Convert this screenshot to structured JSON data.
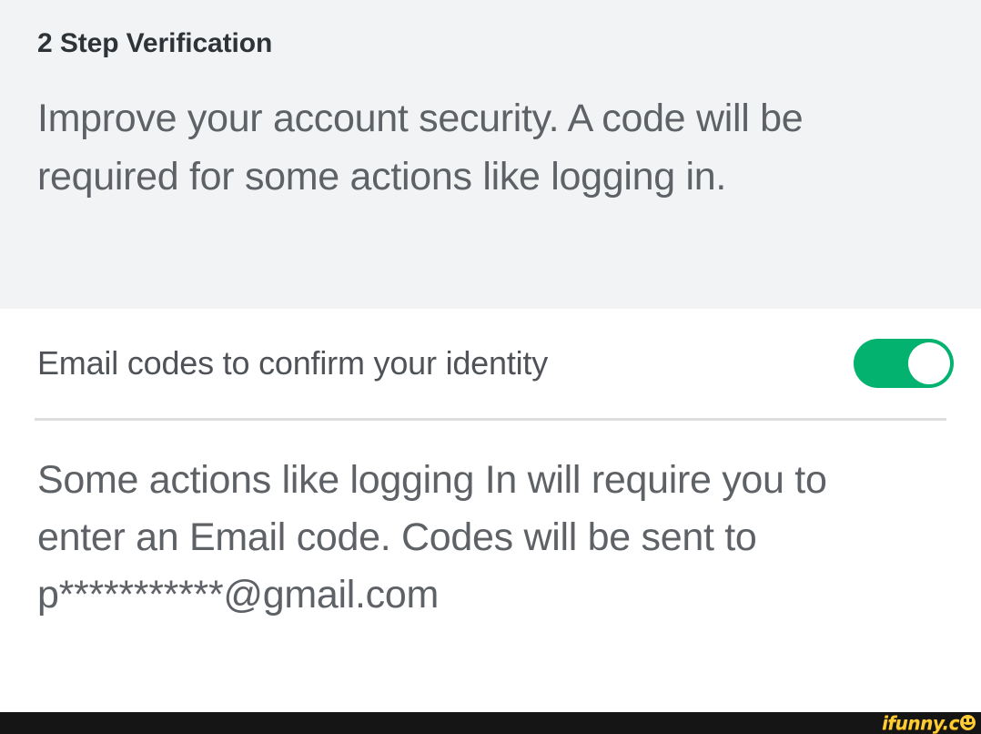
{
  "header": {
    "title": "2 Step Verification",
    "description": "Improve your account security. A code will be required for some actions like logging in."
  },
  "setting_row": {
    "label": "Email codes to confirm your identity",
    "toggle_state": "on",
    "toggle_color": "#03b26e",
    "knob_color": "#ffffff"
  },
  "footnote": {
    "text": "Some actions like logging In will require you to enter an Email code. Codes will be sent to p***********@gmail.com"
  },
  "watermark": {
    "text": "ifunny.c",
    "smiley_icon": "smiley-face-icon"
  },
  "colors": {
    "header_background": "#f2f3f5",
    "body_background": "#ffffff",
    "title_text": "#2e3338",
    "body_text": "#5e6266",
    "divider": "#dcdddf",
    "bottom_bar": "#151515",
    "watermark_text": "#ffcc33"
  }
}
